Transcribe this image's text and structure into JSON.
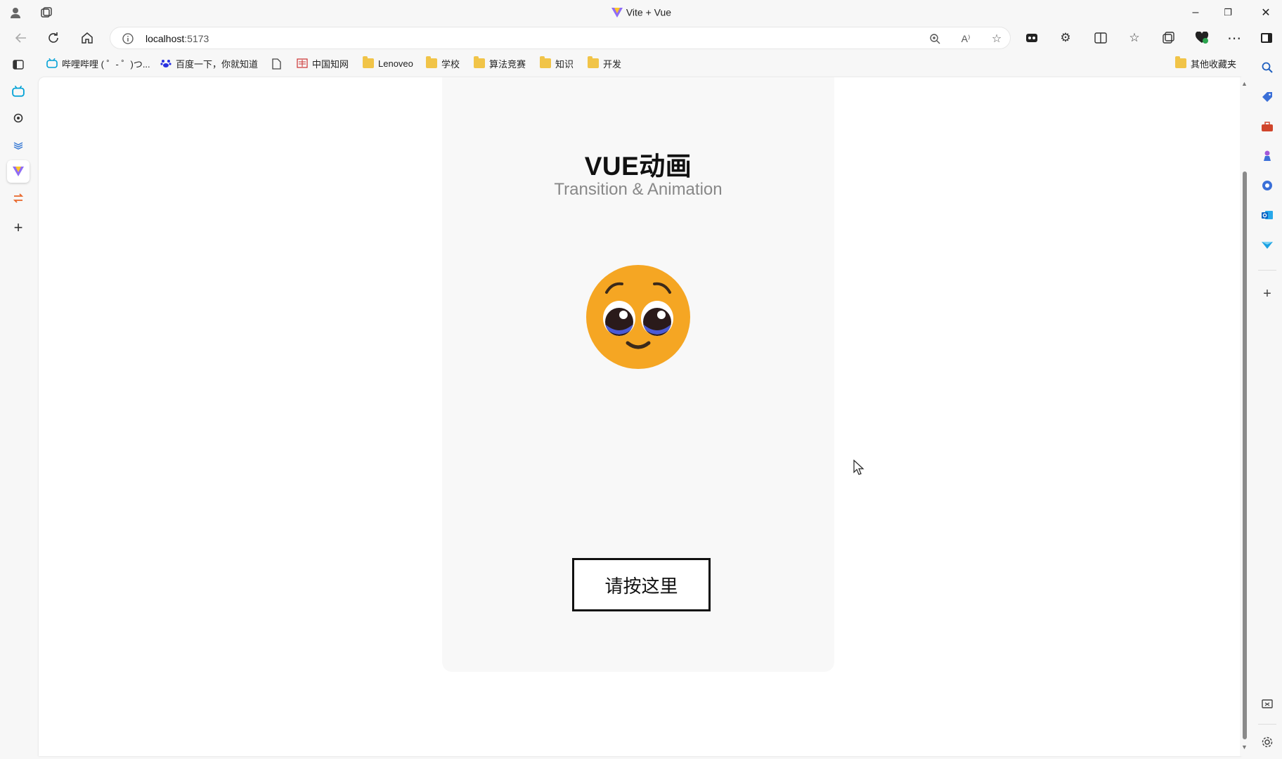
{
  "window": {
    "title": "Vite + Vue",
    "controls": {
      "minimize": "–",
      "restore": "❐",
      "close": "✕"
    }
  },
  "nav": {
    "back_icon": "back-arrow-icon",
    "refresh_icon": "refresh-icon",
    "home_icon": "home-icon",
    "address": {
      "host": "localhost",
      "port": ":5173"
    }
  },
  "bookmarks": [
    {
      "label": "哔哩哔哩 ( ゜- ゜)つ...",
      "icon": "bilibili-icon"
    },
    {
      "label": "百度一下，你就知道",
      "icon": "baidu-icon"
    },
    {
      "label": "",
      "icon": "page-icon"
    },
    {
      "label": "中国知网",
      "icon": "cnki-icon"
    },
    {
      "label": "Lenoveo",
      "icon": "folder-icon"
    },
    {
      "label": "学校",
      "icon": "folder-icon"
    },
    {
      "label": "算法竞赛",
      "icon": "folder-icon"
    },
    {
      "label": "知识",
      "icon": "folder-icon"
    },
    {
      "label": "开发",
      "icon": "folder-icon"
    }
  ],
  "other_bookmarks": "其他收藏夹",
  "page": {
    "heading": "VUE动画",
    "subheading": "Transition & Animation",
    "emoji": "pleading-face-icon",
    "button_label": "请按这里"
  },
  "colors": {
    "accent_vue_green": "#42b883",
    "emoji_yellow": "#f5a623",
    "card_bg": "#f8f8f8"
  }
}
